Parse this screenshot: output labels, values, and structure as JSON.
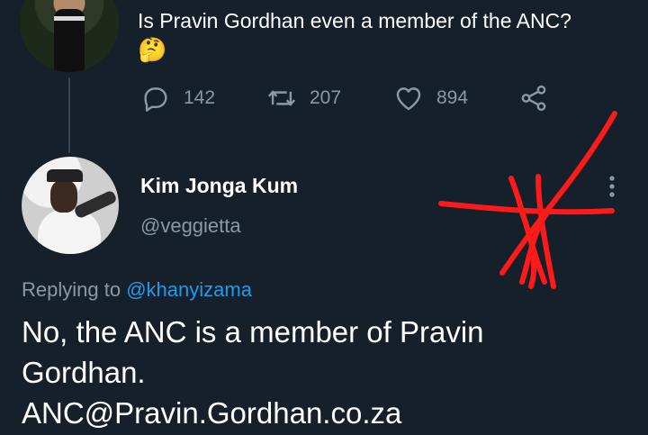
{
  "top_tweet": {
    "text": "Is Pravin Gordhan even a member of the ANC?",
    "emoji": "🤔",
    "actions": {
      "replies": "142",
      "retweets": "207",
      "likes": "894"
    }
  },
  "reply_tweet": {
    "display_name": "Kim Jonga Kum",
    "handle": "@veggietta",
    "replying_prefix": "Replying to",
    "replying_to": "@khanyizama",
    "body_lines": [
      "No, the ANC is a member of Pravin",
      "Gordhan.",
      "ANC@Pravin.Gordhan.co.za"
    ]
  },
  "colors": {
    "background": "#15202b",
    "secondary_text": "#8b98a5",
    "link": "#1d9bf0",
    "annotation": "#ff1a1a"
  },
  "icons": [
    "reply-icon",
    "retweet-icon",
    "like-icon",
    "share-icon",
    "more-options-icon"
  ]
}
